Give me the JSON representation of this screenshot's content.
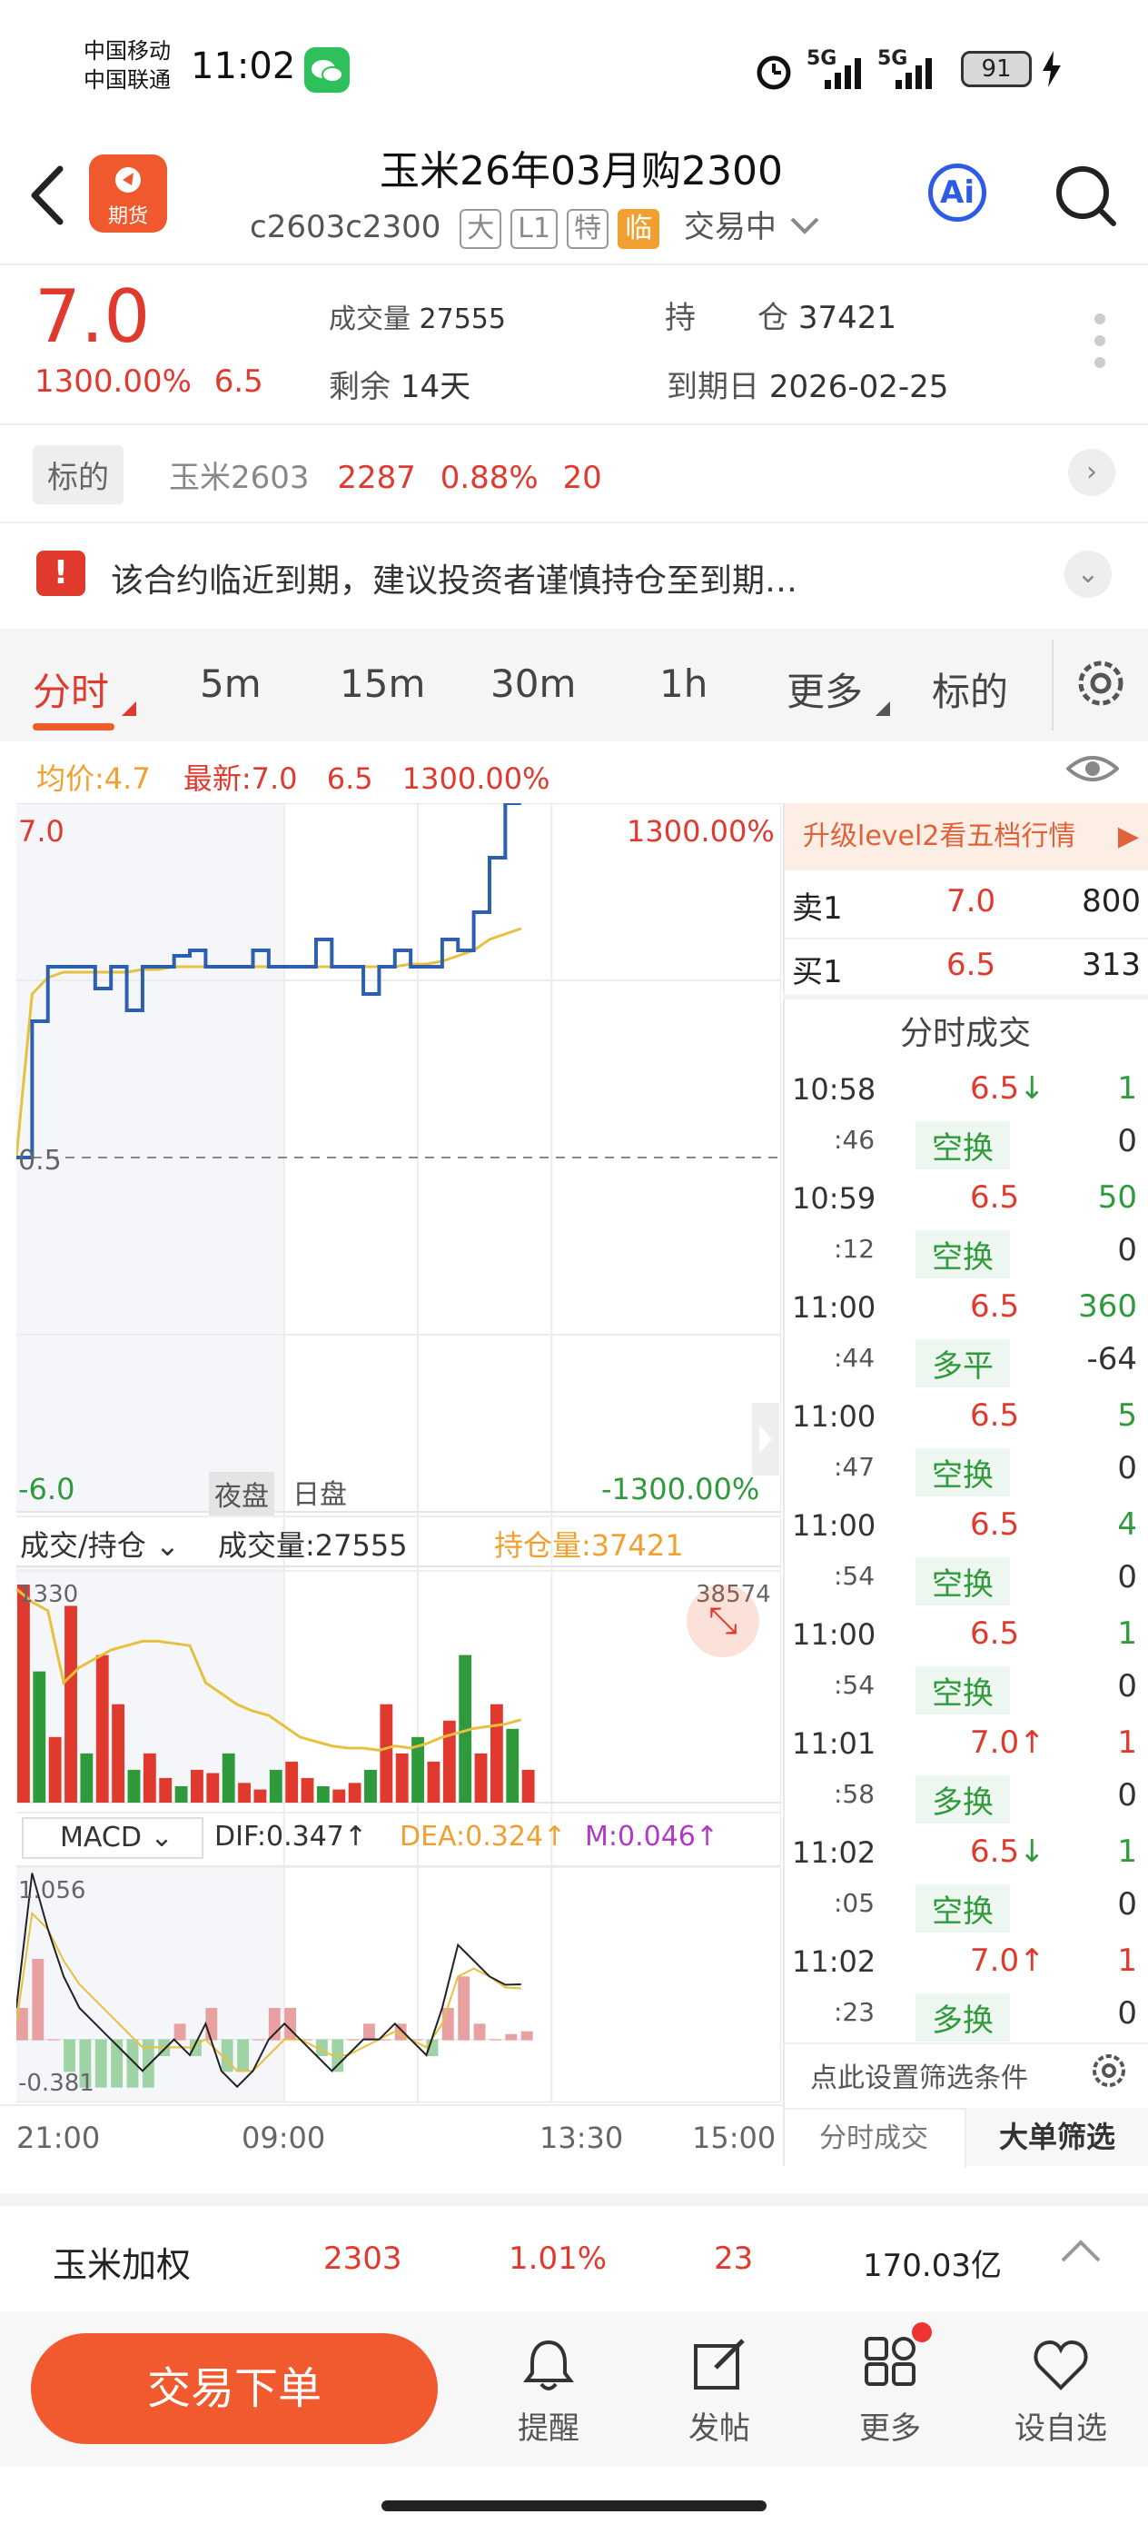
{
  "status": {
    "carrier1": "中国移动",
    "carrier2": "中国联通",
    "time": "11:02",
    "network1": "5G",
    "network2": "5G",
    "battery": "91"
  },
  "header": {
    "logo_text": "期货",
    "title": "玉米26年03月购2300",
    "code": "c2603c2300",
    "tags": [
      "大",
      "L1",
      "特",
      "临"
    ],
    "trade_status": "交易中",
    "ai_label": "Ai"
  },
  "info": {
    "price": "7.0",
    "change_pct": "1300.00%",
    "change_val": "6.5",
    "volume_label": "成交量",
    "volume": "27555",
    "oi_label": "持　　仓",
    "oi": "37421",
    "remain_label": "剩余",
    "remain": "14天",
    "expiry_label": "到期日",
    "expiry": "2026-02-25"
  },
  "underlying": {
    "label": "标的",
    "name": "玉米2603",
    "price": "2287",
    "pct": "0.88%",
    "change": "20"
  },
  "warning": {
    "text": "该合约临近到期，建议投资者谨慎持仓至到期…"
  },
  "tabs": [
    "分时",
    "5m",
    "15m",
    "30m",
    "1h",
    "更多",
    "标的"
  ],
  "avg_line": {
    "avg": "均价:4.7",
    "latest": "最新:7.0",
    "change": "6.5",
    "pct": "1300.00%"
  },
  "chart_labels": {
    "y_top": "7.0",
    "y_top_right": "1300.00%",
    "y_mid": "0.5",
    "y_bottom": "-6.0",
    "y_bottom_right": "-1300.00%",
    "night": "夜盘",
    "day": "日盘"
  },
  "volume_panel": {
    "selector": "成交/持仓",
    "volume": "成交量:27555",
    "oi": "持仓量:37421",
    "left_max": "1330",
    "right_max": "38574"
  },
  "macd_panel": {
    "selector": "MACD",
    "dif": "DIF:0.347",
    "dea": "DEA:0.324",
    "m": "M:0.046",
    "top": "1.056",
    "bottom": "-0.381"
  },
  "x_axis": [
    "21:00",
    "09:00",
    "13:30",
    "15:00"
  ],
  "orderbook": {
    "upgrade": "升级level2看五档行情",
    "sell_label": "卖1",
    "sell_price": "7.0",
    "sell_vol": "800",
    "buy_label": "买1",
    "buy_price": "6.5",
    "buy_vol": "313"
  },
  "trades_title": "分时成交",
  "trades": [
    {
      "time": "10:58",
      "sec": ":46",
      "price": "6.5",
      "dir": "down",
      "vol": "1",
      "type": "空换",
      "type_vol": "0"
    },
    {
      "time": "10:59",
      "sec": ":12",
      "price": "6.5",
      "dir": "",
      "vol": "50",
      "type": "空换",
      "type_vol": "0"
    },
    {
      "time": "11:00",
      "sec": ":44",
      "price": "6.5",
      "dir": "",
      "vol": "360",
      "type": "多平",
      "type_vol": "-64"
    },
    {
      "time": "11:00",
      "sec": ":47",
      "price": "6.5",
      "dir": "",
      "vol": "5",
      "type": "空换",
      "type_vol": "0"
    },
    {
      "time": "11:00",
      "sec": ":54",
      "price": "6.5",
      "dir": "",
      "vol": "4",
      "type": "空换",
      "type_vol": "0"
    },
    {
      "time": "11:00",
      "sec": ":54",
      "price": "6.5",
      "dir": "",
      "vol": "1",
      "type": "空换",
      "type_vol": "0"
    },
    {
      "time": "11:01",
      "sec": ":58",
      "price": "7.0",
      "dir": "up",
      "vol": "1",
      "type": "多换",
      "type_vol": "0"
    },
    {
      "time": "11:02",
      "sec": ":05",
      "price": "6.5",
      "dir": "down",
      "vol": "1",
      "type": "空换",
      "type_vol": "0"
    },
    {
      "time": "11:02",
      "sec": ":23",
      "price": "7.0",
      "dir": "up",
      "vol": "1",
      "type": "多换",
      "type_vol": "0"
    }
  ],
  "filter": "点此设置筛选条件",
  "bottom_tabs": [
    "分时成交",
    "大单筛选"
  ],
  "footer_info": {
    "name": "玉米加权",
    "price": "2303",
    "pct": "1.01%",
    "change": "23",
    "amount": "170.03亿"
  },
  "footer_nav": {
    "trade_button": "交易下单",
    "items": [
      "提醒",
      "发帖",
      "更多",
      "设自选"
    ]
  },
  "colors": {
    "up": "#e03a2f",
    "down": "#2e9a3c",
    "accent": "#f05a2e",
    "price_line": "#2d5fb0",
    "avg_line": "#e8c040"
  },
  "chart_data": {
    "type": "line",
    "x_ticks": [
      "21:00",
      "09:00",
      "13:30",
      "15:00"
    ],
    "ylim": [
      -6.0,
      7.0
    ],
    "price": [
      0.5,
      3.0,
      4.0,
      4.0,
      4.0,
      3.6,
      4.0,
      3.2,
      4.0,
      4.0,
      4.2,
      4.3,
      4.0,
      4.0,
      4.0,
      4.3,
      4.0,
      4.0,
      4.0,
      4.5,
      4.0,
      4.0,
      3.5,
      4.0,
      4.3,
      4.0,
      4.0,
      4.5,
      4.3,
      5.0,
      6.0,
      7.0,
      7.0
    ],
    "avg": [
      0.5,
      3.5,
      3.8,
      3.9,
      3.9,
      3.9,
      3.9,
      3.9,
      3.95,
      3.95,
      4.0,
      4.0,
      4.0,
      4.0,
      4.0,
      4.0,
      4.0,
      4.0,
      4.0,
      4.0,
      4.0,
      4.0,
      4.0,
      4.0,
      4.0,
      4.05,
      4.05,
      4.1,
      4.2,
      4.3,
      4.5,
      4.6,
      4.7
    ],
    "volume": [
      1330,
      800,
      400,
      1200,
      300,
      900,
      600,
      200,
      300,
      150,
      100,
      200,
      180,
      300,
      120,
      80,
      200,
      250,
      150,
      100,
      80,
      120,
      200,
      600,
      300,
      400,
      250,
      500,
      900,
      300,
      600,
      450,
      200
    ],
    "open_interest": [
      0.98,
      0.92,
      0.88,
      0.55,
      0.62,
      0.66,
      0.7,
      0.72,
      0.74,
      0.74,
      0.73,
      0.72,
      0.55,
      0.5,
      0.45,
      0.42,
      0.4,
      0.35,
      0.3,
      0.28,
      0.26,
      0.25,
      0.25,
      0.24,
      0.26,
      0.25,
      0.27,
      0.3,
      0.32,
      0.34,
      0.35,
      0.36,
      0.38
    ],
    "macd_dif": [
      0.2,
      1.056,
      0.7,
      0.4,
      0.2,
      0.1,
      0.0,
      -0.1,
      -0.2,
      -0.1,
      0.0,
      -0.1,
      0.1,
      -0.2,
      -0.3,
      -0.2,
      0.0,
      0.1,
      0.0,
      -0.1,
      -0.2,
      -0.1,
      0.0,
      0.0,
      0.1,
      0.0,
      -0.1,
      0.2,
      0.6,
      0.5,
      0.4,
      0.347,
      0.35
    ],
    "macd_dea": [
      0.1,
      0.8,
      0.7,
      0.5,
      0.35,
      0.25,
      0.15,
      0.05,
      -0.05,
      -0.05,
      -0.05,
      -0.05,
      0.0,
      -0.1,
      -0.2,
      -0.2,
      -0.1,
      0.0,
      0.0,
      -0.05,
      -0.1,
      -0.1,
      -0.05,
      0.0,
      0.05,
      0.0,
      -0.05,
      0.1,
      0.4,
      0.45,
      0.4,
      0.33,
      0.324
    ]
  }
}
